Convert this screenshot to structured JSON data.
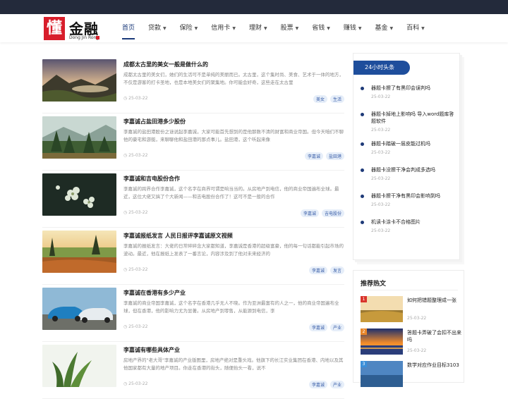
{
  "site": {
    "logo_mark": "懂",
    "logo_text": "金融",
    "logo_sub": "Dong Jin Rong"
  },
  "nav": [
    {
      "label": "首页",
      "has_dropdown": false,
      "active": true
    },
    {
      "label": "贷款",
      "has_dropdown": true
    },
    {
      "label": "保险",
      "has_dropdown": true
    },
    {
      "label": "信用卡",
      "has_dropdown": true
    },
    {
      "label": "理财",
      "has_dropdown": true
    },
    {
      "label": "股票",
      "has_dropdown": true
    },
    {
      "label": "省钱",
      "has_dropdown": true
    },
    {
      "label": "赚钱",
      "has_dropdown": true
    },
    {
      "label": "基金",
      "has_dropdown": true
    },
    {
      "label": "百科",
      "has_dropdown": true
    }
  ],
  "articles": [
    {
      "title": "成都太古里的美女一般是做什么的",
      "summary": "成都太古里的美女们，她们的生活可不是单纯的美丽而已。太古里，这个集时尚、美食、艺术于一体的地方，不仅是游客的打卡圣地，也是本地美女们的聚集地。你可能会好奇，这些走在太古里",
      "date": "25-03-22",
      "tags": [
        "美女",
        "生活"
      ],
      "thumb": "lake-sunset"
    },
    {
      "title": "李嘉诚占盐田港多少股份",
      "summary": "李嘉诚的盐田港股份之谜说起李嘉诚，大家可能首先想到的是他那数不清的财富和商业帝国。但今天咱们不聊他的豪宅和游艇，来聊聊他和盐田港的那点事儿。盐田港，这个听起来像",
      "date": "25-03-22",
      "tags": [
        "李嘉诚",
        "盐田港"
      ],
      "thumb": "forest"
    },
    {
      "title": "李嘉诚和吉电股份合作",
      "summary": "李嘉诚的跨界合作李嘉诚，这个名字在商界可谓是响当当的。从房地产到电信，他的商业帝国遍布全球。最近，这位大佬又搞了个大新闻——和吉电股份合作了！这可不是一般的合作",
      "date": "25-03-22",
      "tags": [
        "李嘉诚",
        "吉电股份"
      ],
      "thumb": "flowers"
    },
    {
      "title": "李嘉诚报纸发言 人民日报评李嘉诚原文视频",
      "summary": "李嘉诚的报纸发言：大佬的日常碎碎念大家都知道，李嘉诚是香港的超级富豪，他的每一句话都能引起市场的波动。最近，他在报纸上发表了一番言论，内容涉及到了他对未来经济的",
      "date": "25-03-22",
      "tags": [
        "李嘉诚",
        "发言"
      ],
      "thumb": "meadow"
    },
    {
      "title": "李嘉诚在香港有多少产业",
      "summary": "李嘉诚的商业帝国李嘉诚，这个名字在香港几乎无人不晓。作为亚洲最富有的人之一，他的商业帝国遍布全球，但在香港，他的影响力尤为显著。从房地产到零售，从能源到电信，李",
      "date": "25-03-22",
      "tags": [
        "李嘉诚",
        "产业"
      ],
      "thumb": "cars"
    },
    {
      "title": "李嘉诚有哪些具体产业",
      "summary": "房地产界的\"老大哥\"李嘉诚的产业版图里，房地产绝对是重头戏。他旗下的长江实业集团在香港、内地以及其他国家都有大量的地产项目。你走在香港的街头，随便抬头一看，说不",
      "date": "25-03-22",
      "tags": [
        "李嘉诚",
        "产业"
      ],
      "thumb": "plant"
    }
  ],
  "hot24": {
    "header": "24小时头条",
    "items": [
      {
        "title": "器题卡擦了有黑印会误判吗",
        "date": "25-03-22"
      },
      {
        "title": "器题卡掉地上影响吗 导入word题库答题软件",
        "date": "25-03-22"
      },
      {
        "title": "器题卡踏破一层皮能过机吗",
        "date": "25-03-22"
      },
      {
        "title": "器题卡没擦干净会判成多选吗",
        "date": "25-03-22"
      },
      {
        "title": "器题卡擦干净有黑印会影响到吗",
        "date": "25-03-22"
      },
      {
        "title": "机读卡涂卡不合格图片",
        "date": "25-03-22"
      }
    ]
  },
  "recommend": {
    "header": "推荐热文",
    "items": [
      {
        "rank": "1",
        "title": "如何把错题整理成一张",
        "date": "25-03-22",
        "thumb": "field"
      },
      {
        "rank": "2",
        "title": "答题卡弄破了会扣不出来吗",
        "date": "25-03-22",
        "thumb": "sunset"
      },
      {
        "rank": "3",
        "title": "数学对应作业目标3103",
        "date": "",
        "thumb": "sea"
      }
    ]
  },
  "colors": {
    "topbar": "#232a3b",
    "accent": "#1e4e9c",
    "logo_red": "#d81e2b",
    "tag_bg": "#e6eef9"
  }
}
